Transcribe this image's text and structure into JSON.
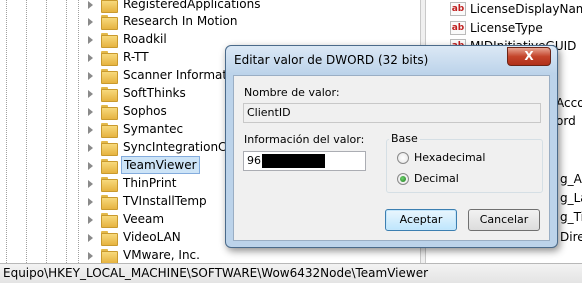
{
  "tree": {
    "items": [
      {
        "label": "RegisteredApplications"
      },
      {
        "label": "Research In Motion"
      },
      {
        "label": "Roadkil"
      },
      {
        "label": "R-TT"
      },
      {
        "label": "Scanner Information"
      },
      {
        "label": "SoftThinks"
      },
      {
        "label": "Sophos"
      },
      {
        "label": "Symantec"
      },
      {
        "label": "SyncIntegrationClie"
      },
      {
        "label": "TeamViewer"
      },
      {
        "label": "ThinPrint"
      },
      {
        "label": "TVInstallTemp"
      },
      {
        "label": "Veeam"
      },
      {
        "label": "VideoLAN"
      },
      {
        "label": "VMware, Inc."
      }
    ],
    "selected_index": 9
  },
  "values_pane": {
    "items": [
      {
        "label": "LicenseDisplayName"
      },
      {
        "label": "LicenseType"
      },
      {
        "label": "MIDInitiativeGUID"
      },
      {
        "label": "Acco"
      },
      {
        "label": "ord"
      },
      {
        "label": "g_A"
      },
      {
        "label": "g_La"
      },
      {
        "label": "g_Ti"
      },
      {
        "label": "Direc"
      }
    ]
  },
  "statusbar": {
    "path": "Equipo\\HKEY_LOCAL_MACHINE\\SOFTWARE\\Wow6432Node\\TeamViewer"
  },
  "dialog": {
    "title": "Editar valor de DWORD (32 bits)",
    "close_label": "X",
    "value_name_label": "Nombre de valor:",
    "value_name": "ClientID",
    "value_data_label": "Información del valor:",
    "value_data": "96",
    "base_label": "Base",
    "radio_hex": "Hexadecimal",
    "radio_dec": "Decimal",
    "selected_base": "Decimal",
    "ok_label": "Aceptar",
    "cancel_label": "Cancelar"
  }
}
